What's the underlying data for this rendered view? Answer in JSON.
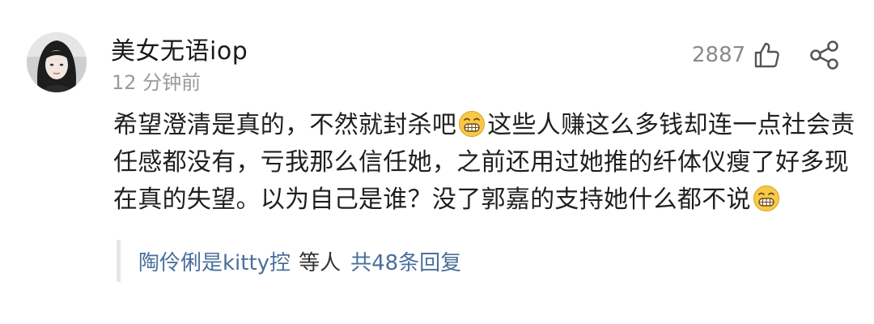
{
  "comment": {
    "author": "美女无语iop",
    "time": "12 分钟前",
    "like_count": "2887",
    "body_lines": [
      {
        "before": "希望澄清是真的，不然就封杀吧",
        "after": "这些人赚这么多钱却连一点社会责"
      },
      {
        "text": "任感都没有，亏我那么信任她，之前还用过她推的纤体仪瘦了好多现"
      },
      {
        "before": "在真的失望。以为自己是谁？没了郭嘉的支持她什么都不说",
        "after": ""
      }
    ],
    "replies": {
      "names": "陶伶俐是kitty控",
      "etc": "等人",
      "total": "共48条回复"
    }
  },
  "icons": {
    "like": "thumbs-up-icon",
    "share": "share-icon",
    "emoji": "grinning-face-emoji"
  },
  "colors": {
    "link": "#4a6f9c",
    "muted": "#9a9a9a",
    "emoji_yellow": "#f7c948"
  }
}
